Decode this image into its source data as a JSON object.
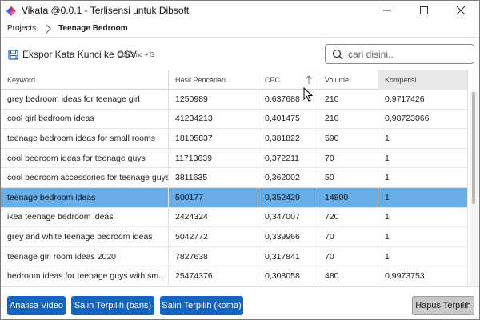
{
  "window": {
    "title": "Vikata @0.0.1 - Terlisensi untuk Dibsoft",
    "icon": "diamond-logo-icon",
    "controls": [
      "minimize-icon",
      "maximize-icon",
      "close-icon"
    ]
  },
  "breadcrumb": {
    "root": "Projects",
    "current": "Teenage Bedroom"
  },
  "toolbar": {
    "export_label": "Ekspor Kata Kunci ke CSV",
    "export_shortcut": "Ctrl/Cmd + S",
    "search_placeholder": "cari disini.."
  },
  "table": {
    "columns": [
      "Keyword",
      "Hasil Pencarian",
      "CPC",
      "Volume",
      "Kompetisi"
    ],
    "sorted_column": "CPC",
    "active_column": "Kompetisi",
    "selected_row": 5,
    "rows": [
      [
        "grey bedroom ideas for teenage girl",
        "1250989",
        "0,637688",
        "210",
        "0,9717426"
      ],
      [
        "cool girl bedroom ideas",
        "41234213",
        "0,401475",
        "210",
        "0,98723066"
      ],
      [
        "teenage bedroom ideas for small rooms",
        "18105837",
        "0,381822",
        "590",
        "1"
      ],
      [
        "cool bedroom ideas for teenage guys",
        "11713639",
        "0,372211",
        "70",
        "1"
      ],
      [
        "cool bedroom accessories for teenage guys",
        "3811635",
        "0,362002",
        "50",
        "1"
      ],
      [
        "teenage bedroom ideas",
        "500177",
        "0,352429",
        "14800",
        "1"
      ],
      [
        "ikea teenage bedroom ideas",
        "2424324",
        "0,347007",
        "720",
        "1"
      ],
      [
        "grey and white teenage bedroom ideas",
        "5042772",
        "0,339966",
        "70",
        "1"
      ],
      [
        "teenage girl room ideas 2020",
        "7827638",
        "0,317841",
        "70",
        "1"
      ],
      [
        "bedroom ideas for teenage guys with sm...",
        "25474376",
        "0,308058",
        "480",
        "0,9973753"
      ]
    ]
  },
  "footer": {
    "analyze_video": "Analisa Video",
    "copy_rows": "Salin Terpilih (baris)",
    "copy_comma": "Salin Terpilih (koma)",
    "delete_selected": "Hapus Terpilih"
  },
  "colors": {
    "primary_button": "#1565c0",
    "selected_row": "#6aaee8",
    "active_header": "#e8e8e8"
  }
}
